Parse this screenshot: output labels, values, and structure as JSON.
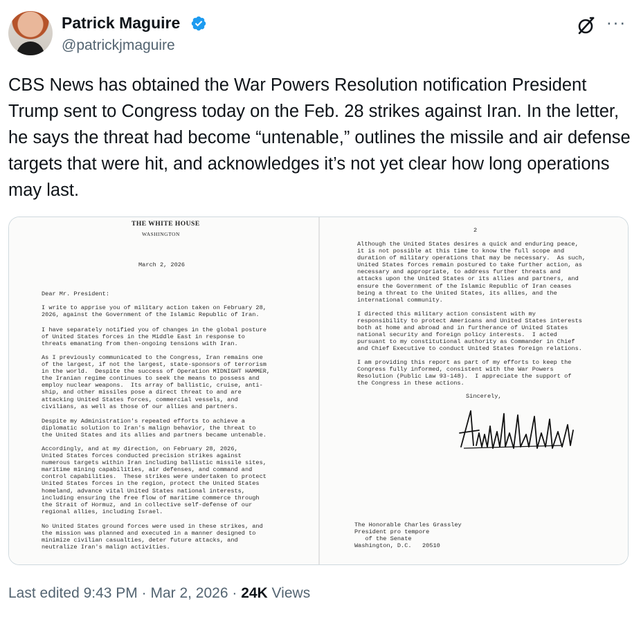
{
  "author": {
    "name": "Patrick Maguire",
    "handle": "@patrickjmaguire"
  },
  "icons": {
    "verified": "verified-badge-icon",
    "grok": "grok-icon",
    "more": "more-icon"
  },
  "colors": {
    "accent": "#1d9bf0",
    "text": "#0f1419",
    "secondary": "#536471"
  },
  "tweet": {
    "text": "CBS News has obtained the War Powers Resolution notification President Trump sent to Congress today on the Feb. 28 strikes against Iran. In the letter, he says the threat had become “untenable,” outlines the missile and air defense targets that were hit, and acknowledges it’s not yet clear how long operations may last."
  },
  "letter": {
    "page1": {
      "letterhead": "THE WHITE HOUSE",
      "location": "WASHINGTON",
      "date": "March 2, 2026",
      "salutation": "Dear Mr. President:",
      "paragraphs": [
        "I write to apprise you of military action taken on February 28,\n2026, against the Government of the Islamic Republic of Iran.",
        "I have separately notified you of changes in the global posture\nof United States forces in the Middle East in response to\nthreats emanating from then-ongoing tensions with Iran.",
        "As I previously communicated to the Congress, Iran remains one\nof the largest, if not the largest, state-sponsors of terrorism\nin the world.  Despite the success of Operation MIDNIGHT HAMMER,\nthe Iranian regime continues to seek the means to possess and\nemploy nuclear weapons.  Its array of ballistic, cruise, anti-\nship, and other missiles pose a direct threat to and are\nattacking United States forces, commercial vessels, and\ncivilians, as well as those of our allies and partners.",
        "Despite my Administration's repeated efforts to achieve a\ndiplomatic solution to Iran's malign behavior, the threat to\nthe United States and its allies and partners became untenable.",
        "Accordingly, and at my direction, on February 28, 2026,\nUnited States forces conducted precision strikes against\nnumerous targets within Iran including ballistic missile sites,\nmaritime mining capabilities, air defenses, and command and\ncontrol capabilities.  These strikes were undertaken to protect\nUnited States forces in the region, protect the United States\nhomeland, advance vital United States national interests,\nincluding ensuring the free flow of maritime commerce through\nthe Strait of Hormuz, and in collective self-defense of our\nregional allies, including Israel.",
        "No United States ground forces were used in these strikes, and\nthe mission was planned and executed in a manner designed to\nminimize civilian casualties, deter future attacks, and\nneutralize Iran's malign activities."
      ]
    },
    "page2": {
      "page_number": "2",
      "paragraphs": [
        "Although the United States desires a quick and enduring peace,\nit is not possible at this time to know the full scope and\nduration of military operations that may be necessary.  As such,\nUnited States forces remain postured to take further action, as\nnecessary and appropriate, to address further threats and\nattacks upon the United States or its allies and partners, and\nensure the Government of the Islamic Republic of Iran ceases\nbeing a threat to the United States, its allies, and the\ninternational community.",
        "I directed this military action consistent with my\nresponsibility to protect Americans and United States interests\nboth at home and abroad and in furtherance of United States\nnational security and foreign policy interests.  I acted\npursuant to my constitutional authority as Commander in Chief\nand Chief Executive to conduct United States foreign relations.",
        "I am providing this report as part of my efforts to keep the\nCongress fully informed, consistent with the War Powers\nResolution (Public Law 93-148).  I appreciate the support of\nthe Congress in these actions."
      ],
      "closing": "Sincerely,",
      "addressee": "The Honorable Charles Grassley\nPresident pro tempore\n   of the Senate\nWashington, D.C.   20510"
    }
  },
  "footer": {
    "edited": "Last edited 9:43 PM · Mar 2, 2026 · ",
    "views_count": "24K",
    "views_label": " Views"
  }
}
